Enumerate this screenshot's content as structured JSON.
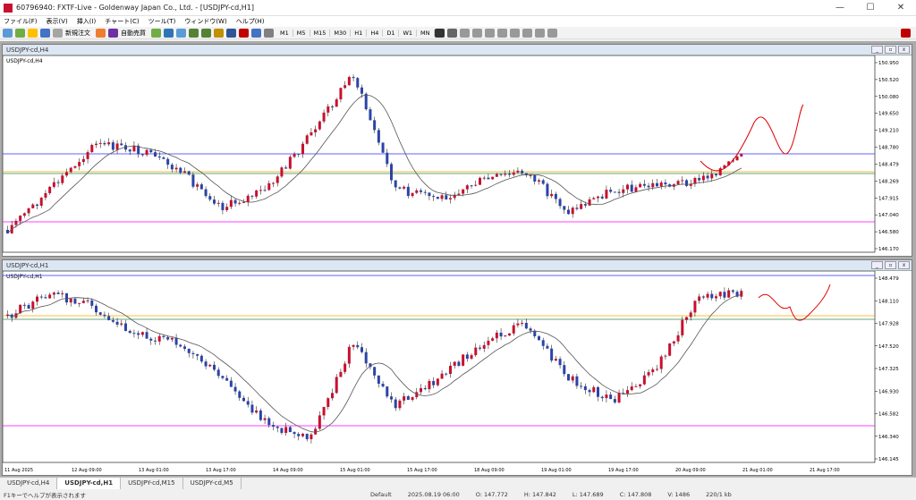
{
  "window": {
    "title": "60796940: FXTF-Live - Goldenway Japan Co., Ltd. - [USDJPY-cd,H1]",
    "minimize": "—",
    "maximize": "☐",
    "close": "✕"
  },
  "menu": [
    "ファイル(F)",
    "表示(V)",
    "挿入(I)",
    "チャート(C)",
    "ツール(T)",
    "ウィンドウ(W)",
    "ヘルプ(H)"
  ],
  "toolbar": {
    "new_order": "新規注文",
    "auto_trade": "自動売買",
    "timeframes": [
      "M1",
      "M5",
      "M15",
      "M30",
      "H1",
      "H4",
      "D1",
      "W1",
      "MN"
    ]
  },
  "chart_h4": {
    "caption": "USDJPY-cd,H4",
    "symbol_label": "USDJPY-cd,H4",
    "price_labels": [
      "150.950",
      "150.520",
      "150.080",
      "149.650",
      "149.210",
      "148.780",
      "148.479",
      "148.269",
      "147.915",
      "147.040",
      "146.580",
      "146.170"
    ],
    "colors": {
      "bull": "#c8102e",
      "bear": "#2a44a8",
      "blue_line": "#3333ff",
      "magenta_line": "#ff00ff",
      "orange_line": "#ffa500",
      "green_line": "#2e8b57",
      "forecast": "#e00000"
    }
  },
  "chart_h1": {
    "caption": "USDJPY-cd,H1",
    "symbol_label": "USDJPY-cd,H1",
    "price_labels": [
      "148.479",
      "148.110",
      "147.928",
      "147.520",
      "147.325",
      "146.930",
      "146.582",
      "146.340",
      "146.145"
    ],
    "time_labels": [
      "11 Aug 2025",
      "12 Aug 09:00",
      "13 Aug 01:00",
      "13 Aug 17:00",
      "14 Aug 09:00",
      "15 Aug 01:00",
      "15 Aug 17:00",
      "18 Aug 09:00",
      "19 Aug 01:00",
      "19 Aug 17:00",
      "20 Aug 09:00",
      "21 Aug 01:00",
      "21 Aug 17:00"
    ]
  },
  "tabs": [
    "USDJPY-cd,H4",
    "USDJPY-cd,H1",
    "USDJPY-cd,M15",
    "USDJPY-cd,M5"
  ],
  "status": {
    "help": "F1キーでヘルプが表示されます",
    "profile": "Default",
    "datetime": "2025.08.19 06:00",
    "open": "O: 147.772",
    "high": "H: 147.842",
    "low": "L: 147.689",
    "close": "C: 147.808",
    "volume": "V: 1486",
    "conn": "220/1 kb"
  }
}
